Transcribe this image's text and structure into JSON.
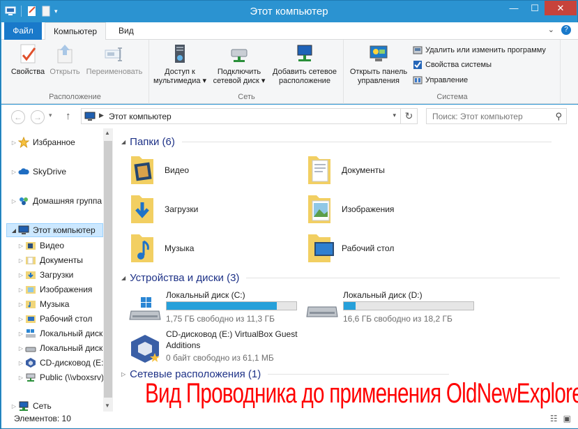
{
  "window": {
    "title": "Этот компьютер",
    "controls": {
      "minimize": "—",
      "maximize": "☐",
      "close": "✕"
    }
  },
  "ribbon_tabs": [
    {
      "label": "Файл"
    },
    {
      "label": "Компьютер"
    },
    {
      "label": "Вид"
    }
  ],
  "ribbon": {
    "location_group": {
      "label": "Расположение",
      "properties": "Свойства",
      "open": "Открыть",
      "rename": "Переименовать"
    },
    "network_group": {
      "label": "Сеть",
      "media_access": [
        "Доступ к",
        "мультимедиа ▾"
      ],
      "map_drive": [
        "Подключить",
        "сетевой диск ▾"
      ],
      "add_location": [
        "Добавить сетевое",
        "расположение"
      ]
    },
    "system_group": {
      "label": "Система",
      "control_panel": [
        "Открыть панель",
        "управления"
      ],
      "uninstall": "Удалить или изменить программу",
      "sys_props": "Свойства системы",
      "manage": "Управление"
    }
  },
  "address": {
    "path": "Этот компьютер",
    "search_placeholder": "Поиск: Этот компьютер"
  },
  "nav_pane": {
    "top": [
      {
        "label": "Избранное"
      },
      {
        "label": "SkyDrive"
      },
      {
        "label": "Домашняя группа"
      },
      {
        "label": "Этот компьютер"
      }
    ],
    "children": [
      {
        "label": "Видео"
      },
      {
        "label": "Документы"
      },
      {
        "label": "Загрузки"
      },
      {
        "label": "Изображения"
      },
      {
        "label": "Музыка"
      },
      {
        "label": "Рабочий стол"
      },
      {
        "label": "Локальный диск (C:)"
      },
      {
        "label": "Локальный диск (D:)"
      },
      {
        "label": "CD-дисковод (E:) VirtualBox Guest Additions"
      },
      {
        "label": "Public (\\\\vboxsrv)"
      }
    ],
    "network": {
      "label": "Сеть"
    }
  },
  "content": {
    "folders_header": "Папки (6)",
    "folders": [
      {
        "label": "Видео"
      },
      {
        "label": "Документы"
      },
      {
        "label": "Загрузки"
      },
      {
        "label": "Изображения"
      },
      {
        "label": "Музыка"
      },
      {
        "label": "Рабочий стол"
      }
    ],
    "devices_header": "Устройства и диски (3)",
    "drives": [
      {
        "name": "Локальный диск (C:)",
        "free": "1,75 ГБ свободно из 11,3 ГБ",
        "used_fraction": 0.85
      },
      {
        "name": "Локальный диск (D:)",
        "free": "16,6 ГБ свободно из 18,2 ГБ",
        "used_fraction": 0.09
      }
    ],
    "cd": {
      "name_line1": "CD-дисковод (E:) VirtualBox Guest",
      "name_line2": "Additions",
      "free": "0 байт свободно из 61,1 МБ"
    },
    "network_header": "Сетевые расположения (1)"
  },
  "caption_overlay": "Вид Проводника до применения OldNewExplorer",
  "status": {
    "count": "Элементов: 10"
  },
  "colors": {
    "accent": "#2b93d1",
    "file_tab": "#1979ca",
    "header_text": "#1e3287",
    "drive_fill": "#26a0da",
    "caption": "#ff0000"
  }
}
